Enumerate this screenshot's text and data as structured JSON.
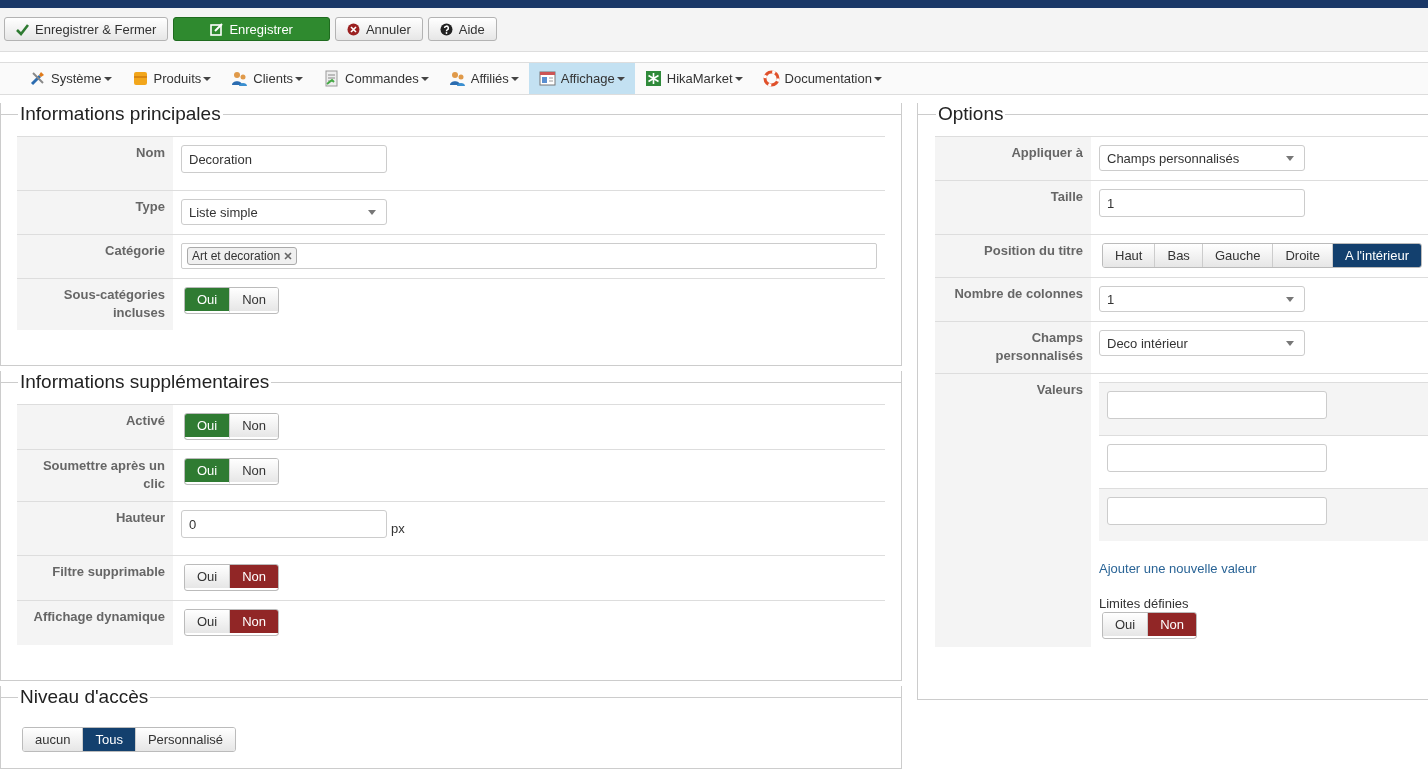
{
  "toolbar": [
    {
      "kind": "save-close",
      "label": "Enregistrer & Fermer"
    },
    {
      "kind": "save",
      "label": "Enregistrer"
    },
    {
      "kind": "cancel",
      "label": "Annuler"
    },
    {
      "kind": "help",
      "label": "Aide"
    }
  ],
  "menu": [
    {
      "kind": "tools",
      "label": "Système",
      "selected": false
    },
    {
      "kind": "box",
      "label": "Produits",
      "selected": false
    },
    {
      "kind": "people",
      "label": "Clients",
      "selected": false
    },
    {
      "kind": "doc",
      "label": "Commandes",
      "selected": false
    },
    {
      "kind": "people",
      "label": "Affiliés",
      "selected": false
    },
    {
      "kind": "window",
      "label": "Affichage",
      "selected": true
    },
    {
      "kind": "star",
      "label": "HikaMarket",
      "selected": false
    },
    {
      "kind": "lifebuoy",
      "label": "Documentation",
      "selected": false
    }
  ],
  "left_panels": [
    {
      "title": "Informations principales",
      "rows": [
        {
          "label": "Nom",
          "kind": "text",
          "value": "Decoration"
        },
        {
          "label": "Type",
          "kind": "select",
          "value": "Liste simple"
        },
        {
          "label": "Catégorie",
          "kind": "tags",
          "tags": [
            "Art et decoration"
          ]
        },
        {
          "label": "Sous-catégories incluses",
          "kind": "toggle",
          "options": [
            {
              "label": "Oui",
              "kind": "yes",
              "selected": true
            },
            {
              "label": "Non",
              "kind": "no",
              "selected": false
            }
          ]
        }
      ]
    },
    {
      "title": "Informations supplémentaires",
      "rows": [
        {
          "label": "Activé",
          "kind": "toggle",
          "options": [
            {
              "label": "Oui",
              "kind": "yes",
              "selected": true
            },
            {
              "label": "Non",
              "kind": "no",
              "selected": false
            }
          ]
        },
        {
          "label": "Soumettre après un clic",
          "kind": "toggle",
          "options": [
            {
              "label": "Oui",
              "kind": "yes",
              "selected": true
            },
            {
              "label": "Non",
              "kind": "no",
              "selected": false
            }
          ]
        },
        {
          "label": "Hauteur",
          "kind": "text",
          "value": "0",
          "unit": "px"
        },
        {
          "label": "Filtre supprimable",
          "kind": "toggle",
          "options": [
            {
              "label": "Oui",
              "kind": "yes",
              "selected": false
            },
            {
              "label": "Non",
              "kind": "no",
              "selected": true
            }
          ]
        },
        {
          "label": "Affichage dynamique",
          "kind": "toggle",
          "options": [
            {
              "label": "Oui",
              "kind": "yes",
              "selected": false
            },
            {
              "label": "Non",
              "kind": "no",
              "selected": true
            }
          ]
        }
      ]
    },
    {
      "title": "Niveau d'accès",
      "rows": [
        {
          "kind": "bare-toggle",
          "options": [
            {
              "label": "aucun",
              "kind": "neutral",
              "selected": false
            },
            {
              "label": "Tous",
              "kind": "neutral",
              "selected": true
            },
            {
              "label": "Personnalisé",
              "kind": "neutral",
              "selected": false
            }
          ]
        }
      ]
    }
  ],
  "options_panel": {
    "title": "Options",
    "rows": [
      {
        "label": "Appliquer à",
        "kind": "select",
        "value": "Champs personnalisés"
      },
      {
        "label": "Taille",
        "kind": "text",
        "value": "1"
      },
      {
        "label": "Position du titre",
        "kind": "toggle",
        "options": [
          {
            "label": "Haut",
            "kind": "neutral",
            "selected": false
          },
          {
            "label": "Bas",
            "kind": "neutral",
            "selected": false
          },
          {
            "label": "Gauche",
            "kind": "neutral",
            "selected": false
          },
          {
            "label": "Droite",
            "kind": "neutral",
            "selected": false
          },
          {
            "label": "A l'intérieur",
            "kind": "neutral",
            "selected": true
          }
        ]
      },
      {
        "label": "Nombre de colonnes",
        "kind": "select",
        "value": "1"
      },
      {
        "label": "Champs personnalisés",
        "kind": "select",
        "value": "Deco intérieur"
      },
      {
        "label": "Valeurs",
        "kind": "values",
        "inputs": [
          {
            "kind": "text"
          },
          {
            "kind": "text"
          },
          {
            "kind": "text"
          }
        ],
        "link": "Ajouter une nouvelle valeur",
        "sublabel": "Limites définies",
        "options": [
          {
            "label": "Oui",
            "kind": "yes",
            "selected": false
          },
          {
            "label": "Non",
            "kind": "no",
            "selected": true
          }
        ]
      }
    ]
  }
}
